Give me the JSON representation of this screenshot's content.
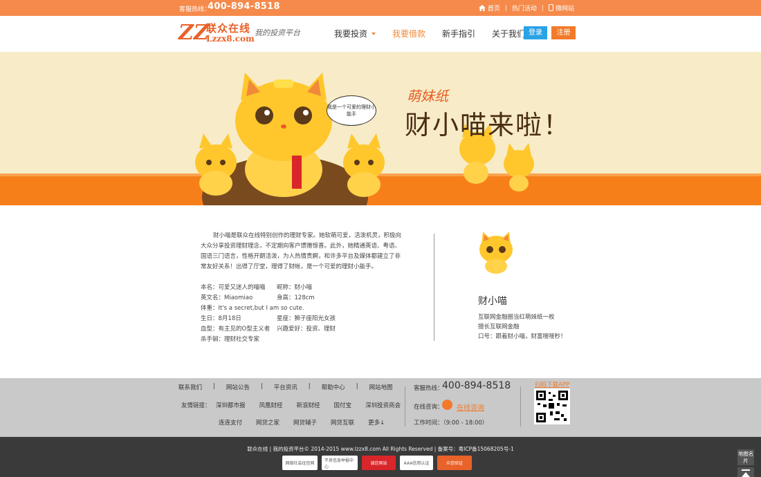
{
  "topbar": {
    "hotline_label": "客服热线：",
    "hotline_number": "400-894-8518",
    "home": "首页",
    "events": "热门活动",
    "mobile": "微网站"
  },
  "header": {
    "logo_mark": "ZZ",
    "logo_name": "联众在线",
    "logo_domain": "Lzzx8.com",
    "logo_slogan": "我的投资平台",
    "nav": [
      "我要投资",
      "我要借款",
      "新手指引",
      "关于我们"
    ],
    "login": "登录",
    "register": "注册"
  },
  "banner": {
    "tagline": "萌妹纸",
    "headline": "财小喵来啦！",
    "bubble": "我是一个可爱的理财小能手"
  },
  "intro": {
    "paragraph": "财小喵是联众在线特别创作的理财专家。她软萌可爱，活泼机灵，积极向大众分享投资理财理念，不定期向客户馈赠惊喜。此外，她精通英语、粤语、国语三门语言，性格开朗活泼，为人热情贵婀，和许多平台及媒体都建立了非常友好关系！出得了厅堂，理得了财帐，是一个可爱的理财小能手。"
  },
  "profile": {
    "rows": [
      [
        "本名：可爱又迷人的喵喵",
        "昵称：财小喵"
      ],
      [
        "英文名：Miaomiao",
        "身高：128cm"
      ],
      [
        "体重：It's a secret,but I am so cute.",
        ""
      ],
      [
        "生日：8月18日",
        "星座：狮子座阳光女孩"
      ],
      [
        "血型：有主见的O型主义者",
        "兴趣爱好：投资、理财"
      ],
      [
        "杀手锏：理财社交专家",
        ""
      ]
    ]
  },
  "side": {
    "name": "财小喵",
    "lines": [
      "互联网金融圈当红萌妹纸一枚",
      "擅长互联网金融",
      "口号：跟着财小喵，财富嗖嗖秒！"
    ]
  },
  "footer": {
    "links": [
      "联系我们",
      "|",
      "网站公告",
      "|",
      "平台资讯",
      "|",
      "帮助中心",
      "|",
      "网站地图"
    ],
    "friend_label": "友情链接：",
    "friends_row1": [
      "深圳都市报",
      "凤凰财经",
      "新浪财经",
      "国付宝",
      "深圳投资商会"
    ],
    "friends_row2": [
      "连连支付",
      "网贷之家",
      "网贷辅子",
      "网贷互联",
      "更多↓"
    ],
    "hotline_label": "客服热线：",
    "hotline_number": "400-894-8518",
    "consult_label": "在线咨询：",
    "consult_link": "在线咨询",
    "work_time": "工作时间：（9:00 - 18:00）",
    "app_link": "扫码下载APP"
  },
  "bottom": {
    "copyright": "联众在线 | 我的投资平台© 2014-2015 www.lzzx8.com All Rights Reserved | 备案号：粤ICP备15068205号-1",
    "badges": [
      "网络社会征信网",
      "不良信息举报中心",
      "诚信网站",
      "AAA信用认证",
      "众信验证"
    ],
    "sitemap_card": "地图名片"
  },
  "colors": {
    "orange": "#f58a4b",
    "accent": "#f08a3a",
    "login_blue": "#2aa2e6",
    "footer_gray": "#c9c9c9",
    "bottom_dark": "#3a3a3a"
  }
}
